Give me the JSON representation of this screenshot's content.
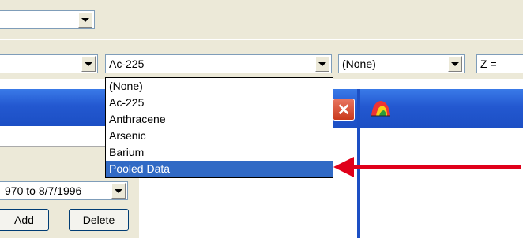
{
  "toolbar_top": {
    "combo_value": ""
  },
  "toolbar_second": {
    "left_combo_value": "",
    "analyte_combo_value": "Ac-225",
    "filter_combo_value": "(None)",
    "z_label": "Z ="
  },
  "dropdown": {
    "options": [
      "(None)",
      "Ac-225",
      "Anthracene",
      "Arsenic",
      "Barium",
      "Pooled Data"
    ],
    "selected_index": 5
  },
  "left_panel": {
    "date_range_value": "970 to 8/7/1996",
    "add_label": "Add",
    "delete_label": "Delete"
  },
  "colors": {
    "toolbar": "#ece9d8",
    "titlebar": "#1c4fc4",
    "selection": "#316ac5",
    "arrow": "#e0001a"
  },
  "icons": [
    "chevron-down-icon",
    "close-icon",
    "chart-app-icon"
  ]
}
